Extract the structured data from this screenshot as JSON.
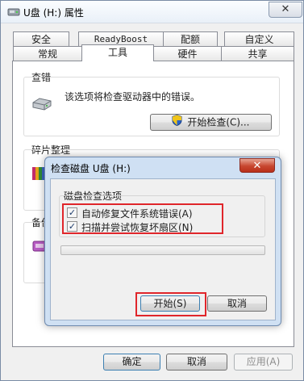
{
  "window": {
    "title": "U盘 (H:) 属性",
    "close": "✕"
  },
  "tabs_row1": [
    {
      "label": "安全",
      "font": "sans"
    },
    {
      "label": "ReadyBoost",
      "font": "mono"
    },
    {
      "label": "配额",
      "font": "sans"
    },
    {
      "label": "自定义",
      "font": "sans"
    }
  ],
  "tabs_row2": [
    {
      "label": "常规"
    },
    {
      "label": "工具"
    },
    {
      "label": "硬件"
    },
    {
      "label": "共享"
    }
  ],
  "error_check": {
    "title": "查错",
    "description": "该选项将检查驱动器中的错误。",
    "button": "开始检查(C)...",
    "icon": "drive-icon"
  },
  "defrag": {
    "title": "碎片整理"
  },
  "backup": {
    "title": "备份"
  },
  "footer": {
    "ok": "确定",
    "cancel": "取消",
    "apply": "应用(A)"
  },
  "dialog": {
    "title": "检查磁盘 U盘 (H:)",
    "close": "✕",
    "group_title": "磁盘检查选项",
    "options": [
      {
        "label": "自动修复文件系统错误(A)",
        "checked": true
      },
      {
        "label": "扫描并尝试恢复坏扇区(N)",
        "checked": true
      }
    ],
    "progress_fraction": 0,
    "start_button": "开始(S)",
    "cancel_button": "取消"
  },
  "colors": {
    "highlight": "#e0262b",
    "close_red": "#c7462f",
    "title_blue": "#cfe0f3"
  }
}
